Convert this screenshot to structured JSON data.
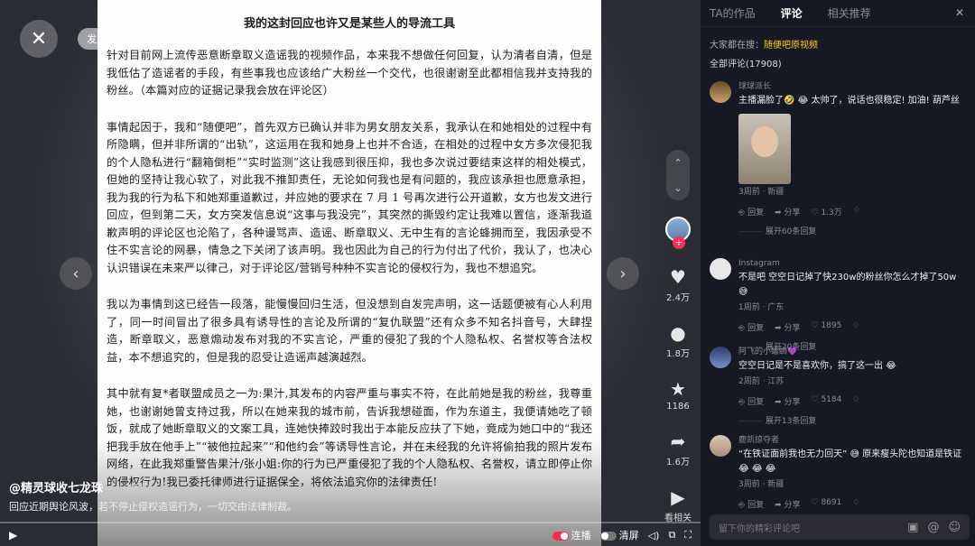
{
  "video": {
    "search_placeholder": "发声音",
    "close_label": "✕",
    "doc_title": "我的这封回应也许又是某些人的导流工具",
    "paragraphs": [
      "针对目前网上流传恶意断章取义造谣我的视频作品，本来我不想做任何回复，认为清者自清，但是我低估了造谣者的手段，有些事我也应该给广大粉丝一个交代，也很谢谢至此都相信我并支持我的粉丝。（本篇对应的证据记录我会放在评论区）",
      "事情起因于，我和“随便吧”，首先双方已确认并非为男女朋友关系，我承认在和她相处的过程中有所隐瞒，但并非所谓的“出轨”，这运用在我和她身上也并不合适，在相处的过程中女方多次侵犯我的个人隐私进行“翻箱倒柜”“实时监测”这让我感到很压抑，我也多次说过要结束这样的相处模式，但她的坚持让我心软了，对此我不推卸责任，无论如何我也是有问题的，我应该承担也愿意承担，我为我的行为私下和她郑重道歉过，并应她的要求在 7 月 1 号再次进行公开道歉，女方也发文进行回应，但到第二天，女方突发信息说“这事与我没完”，其突然的撕毁约定让我难以置信，逐渐我道歉声明的评论区也沦陷了，各种谩骂声、造谣、断章取义、无中生有的言论蜂拥而至，我因承受不住不实言论的网暴，情急之下关闭了该声明。我也因此为自己的行为付出了代价，我认了，也决心认识错误在未来严以律己，对于评论区/营销号种种不实言论的侵权行为，我也不想追究。",
      "我以为事情到这已经告一段落，能慢慢回归生活，但没想到自发完声明，这一话题便被有心人利用了，同一时间冒出了很多具有诱导性的言论及所谓的“复仇联盟”还有众多不知名抖音号，大肆捏造，断章取义，恶意煽动发布对我的不实言论，严重的侵犯了我的个人隐私权、名誉权等合法权益，本不想追究的，但是我的忍受让造谣声越演越烈。",
      "其中就有复*者联盟成员之一为:果汁,其发布的内容严重与事实不符，在此前她是我的粉丝，我尊重她，也谢谢她曾支持过我，所以在她来我的城市前，告诉我想碰面，作为东道主，我便请她吃了顿饭，就成了她断章取义的文案工具，连她快捧跤时我出于本能反应扶了下她，竟成为她口中的“我还把我手放在他手上”“被他拉起来”“和他约会”等诱导性言论，并在未经我的允许将偷拍我的照片发布网络，在此我郑重警告果汁/张小姐:你的行为已严重侵犯了我的个人隐私权、名誉权，请立即停止你的侵权行为!我已委托律师进行证据保全，将依法追究你的法律责任!"
    ],
    "actions": {
      "likes": "2.4万",
      "comments": "1.8万",
      "favorites": "1186",
      "shares": "1.6万",
      "watch_related": "看相关"
    },
    "author": "@精灵球收七龙珠",
    "date": "· 3周前",
    "caption": "回应近期舆论风波，若不停止侵权造谣行为，一切交由法律制裁。",
    "controls": {
      "danmaku": "连播",
      "clear": "清屏"
    }
  },
  "sidebar": {
    "tabs": [
      "TA的作品",
      "评论",
      "相关推荐"
    ],
    "active_tab": 1,
    "close": "✕",
    "search_prefix": "大家都在搜：",
    "search_hot": "随便吧原视频",
    "total": "全部评论(17908)",
    "comments": [
      {
        "name": "球球派长",
        "text": "主播漏脸了🤣 😂 太帅了，说话也很稳定! 加油! 葫芦丝",
        "meta": "3周前 · 新疆",
        "reply": "回复",
        "share": "分享",
        "likes": "1.3万",
        "more": "展开60条回复"
      },
      {
        "name": "Instagram",
        "text": "不是吧 空空日记掉了快230w的粉丝你怎么才掉了50w 😅",
        "meta": "1周前 · 广东",
        "reply": "回复",
        "share": "分享",
        "likes": "1895",
        "more": "展开20条回复"
      },
      {
        "name": "阿飞的小螺蛳💜",
        "text": "空空日记是不是喜欢你，搞了这一出 😂",
        "meta": "2周前 · 江苏",
        "reply": "回复",
        "share": "分享",
        "likes": "5184",
        "more": "展开13条回复"
      },
      {
        "name": "鹿凯掠夺者",
        "text": "“在铁证面前我也无力回天” 😅 原来瘦头陀也知道是铁证 😂 😂 😂",
        "meta": "3周前 · 新疆",
        "reply": "回复",
        "share": "分享",
        "likes": "8691"
      }
    ],
    "composer_placeholder": "留下你的精彩评论吧"
  }
}
